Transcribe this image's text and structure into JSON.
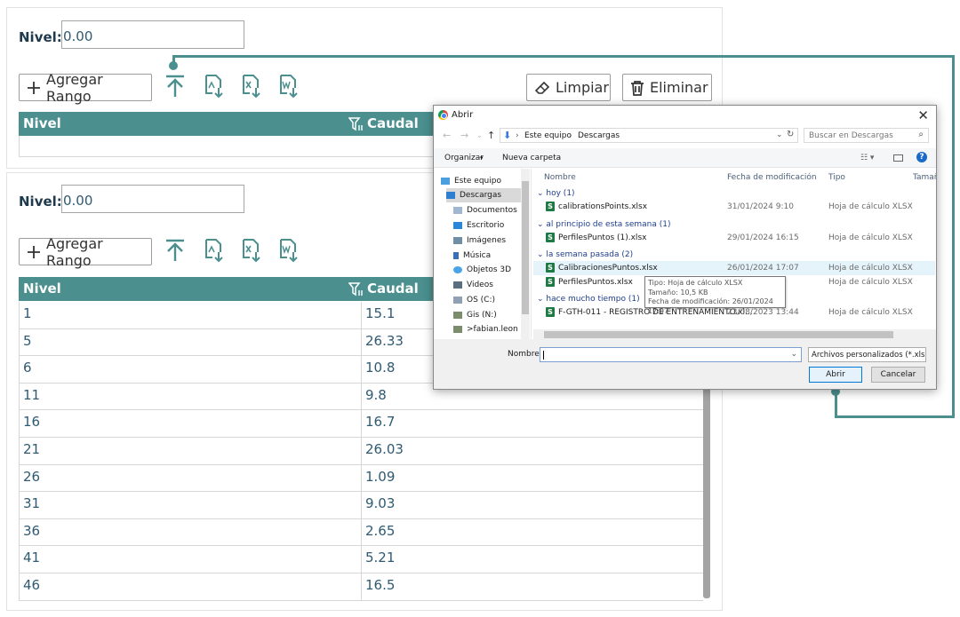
{
  "panel1": {
    "nivel_label": "Nivel:",
    "nivel_value": "0.00",
    "agregar_label": "Agregar Rango",
    "limpiar_label": "Limpiar",
    "eliminar_label": "Eliminar",
    "col_nivel": "Nivel",
    "col_caudal": "Caudal"
  },
  "panel2": {
    "nivel_label": "Nivel:",
    "nivel_value": "0.00",
    "agregar_label": "Agregar Rango",
    "col_nivel": "Nivel",
    "col_caudal": "Caudal",
    "rows": [
      {
        "nivel": "1",
        "caudal": "15.1"
      },
      {
        "nivel": "5",
        "caudal": "26.33"
      },
      {
        "nivel": "6",
        "caudal": "10.8"
      },
      {
        "nivel": "11",
        "caudal": "9.8"
      },
      {
        "nivel": "16",
        "caudal": "16.7"
      },
      {
        "nivel": "21",
        "caudal": "26.03"
      },
      {
        "nivel": "26",
        "caudal": "1.09"
      },
      {
        "nivel": "31",
        "caudal": "9.03"
      },
      {
        "nivel": "36",
        "caudal": "2.65"
      },
      {
        "nivel": "41",
        "caudal": "5.21"
      },
      {
        "nivel": "46",
        "caudal": "16.5"
      }
    ]
  },
  "accent_color": "#4b8f8f",
  "dialog": {
    "title": "Abrir",
    "breadcrumb": [
      "Este equipo",
      "Descargas"
    ],
    "search_placeholder": "Buscar en Descargas",
    "organize": "Organizar",
    "new_folder": "Nueva carpeta",
    "nav_items": [
      "Este equipo",
      "Descargas",
      "Documentos",
      "Escritorio",
      "Imágenes",
      "Música",
      "Objetos 3D",
      "Videos",
      "OS (C:)",
      "Gis (N:)",
      ">fabian.leon (P:)"
    ],
    "columns": [
      "Nombre",
      "Fecha de modificación",
      "Tipo",
      "Tamaño"
    ],
    "groups": [
      "hoy (1)",
      "al principio de esta semana (1)",
      "la semana pasada (2)",
      "hace mucho tiempo (1)"
    ],
    "files": [
      {
        "name": "calibrationsPoints.xlsx",
        "date": "31/01/2024 9:10",
        "type": "Hoja de cálculo XLSX"
      },
      {
        "name": "PerfilesPuntos (1).xlsx",
        "date": "29/01/2024 16:15",
        "type": "Hoja de cálculo XLSX"
      },
      {
        "name": "CalibracionesPuntos.xlsx",
        "date": "26/01/2024 17:07",
        "type": "Hoja de cálculo XLSX"
      },
      {
        "name": "PerfilesPuntos.xlsx",
        "date": "",
        "type": "Hoja de cálculo XLSX"
      },
      {
        "name": "F-GTH-011 - REGISTRO DE ENTRENAMIENTO.xl...",
        "date": "23/08/2023 13:44",
        "type": "Hoja de cálculo XLSX"
      }
    ],
    "tooltip": [
      "Tipo: Hoja de cálculo XLSX",
      "Tamaño: 10,5 KB",
      "Fecha de modificación: 26/01/2024 17:07"
    ],
    "name_label": "Nombre:",
    "filter": "Archivos personalizados (*.xlsx;",
    "open": "Abrir",
    "cancel": "Cancelar"
  }
}
